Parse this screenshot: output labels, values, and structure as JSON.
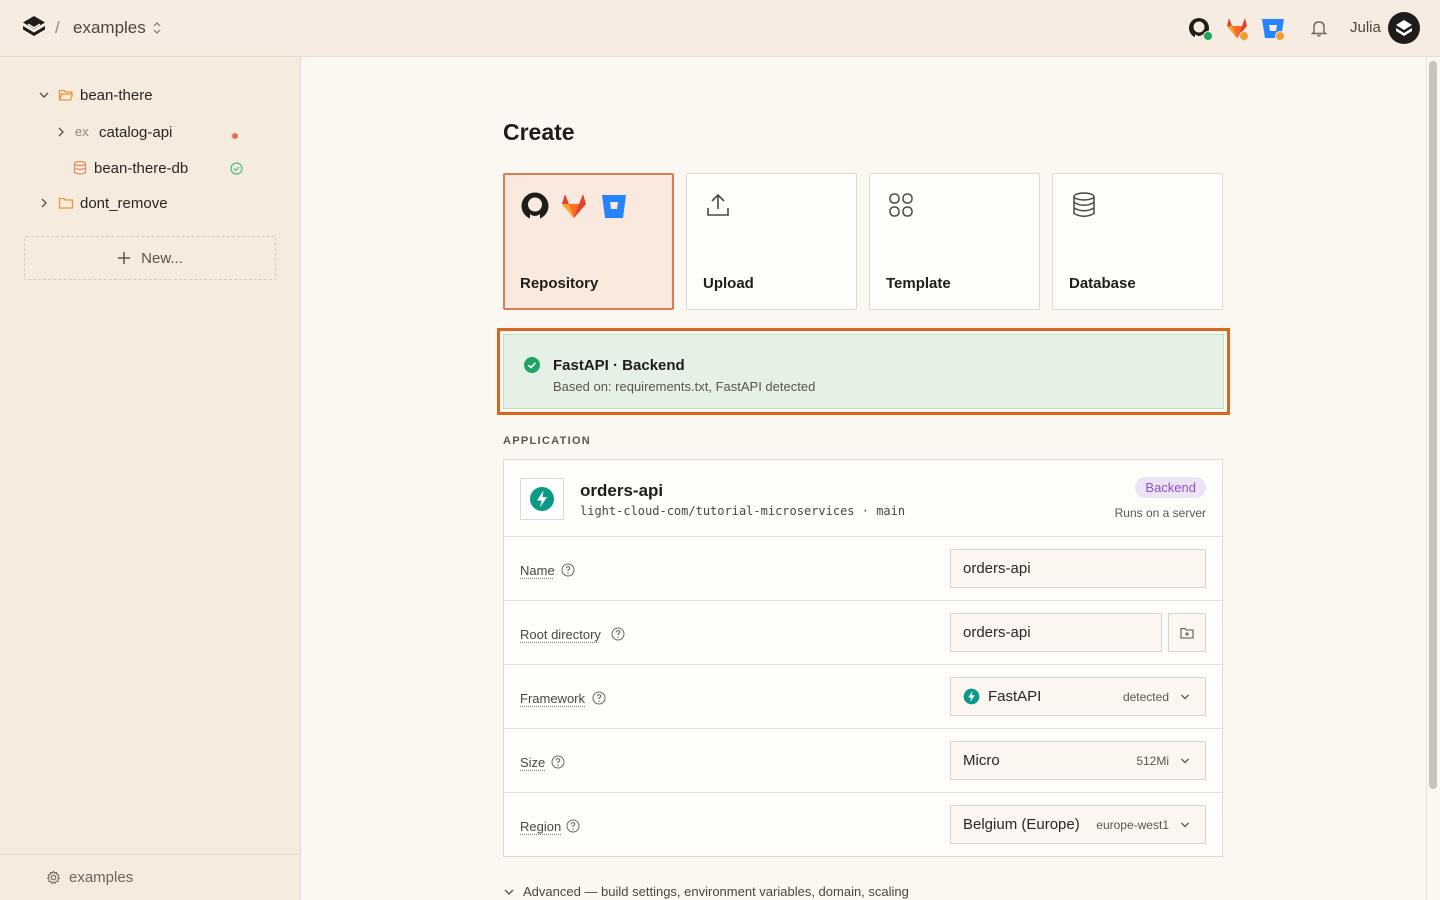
{
  "topbar": {
    "separator": "/",
    "project": "examples",
    "user": "Julia"
  },
  "sidebar": {
    "tree": [
      {
        "label": "bean-there"
      },
      {
        "label": "catalog-api"
      },
      {
        "label": "bean-there-db"
      },
      {
        "label": "dont_remove"
      }
    ],
    "new_button": "New...",
    "footer": "examples"
  },
  "main": {
    "title": "Create",
    "create_options": [
      {
        "label": "Repository",
        "selected": true
      },
      {
        "label": "Upload"
      },
      {
        "label": "Template"
      },
      {
        "label": "Database"
      }
    ],
    "detection": {
      "title": "FastAPI · Backend",
      "subtitle": "Based on: requirements.txt, FastAPI detected"
    },
    "section_label": "APPLICATION",
    "app": {
      "name": "orders-api",
      "repo": "light-cloud-com/tutorial-microservices · main",
      "badge": "Backend",
      "runs": "Runs on a server"
    },
    "fields": {
      "name": {
        "label": "Name",
        "value": "orders-api"
      },
      "root": {
        "label": "Root directory",
        "value": "orders-api"
      },
      "framework": {
        "label": "Framework",
        "value": "FastAPI",
        "hint": "detected"
      },
      "size": {
        "label": "Size",
        "value": "Micro",
        "hint": "512Mi"
      },
      "region": {
        "label": "Region",
        "value": "Belgium (Europe)",
        "hint": "europe-west1"
      }
    },
    "advanced": "Advanced — build settings, environment variables, domain, scaling"
  },
  "colors": {
    "accent": "#e07a55",
    "highlight_border": "#d9661f",
    "success": "#1fa463",
    "badge_purple": "#8a55c8",
    "fastapi_teal": "#0b9a8a"
  }
}
